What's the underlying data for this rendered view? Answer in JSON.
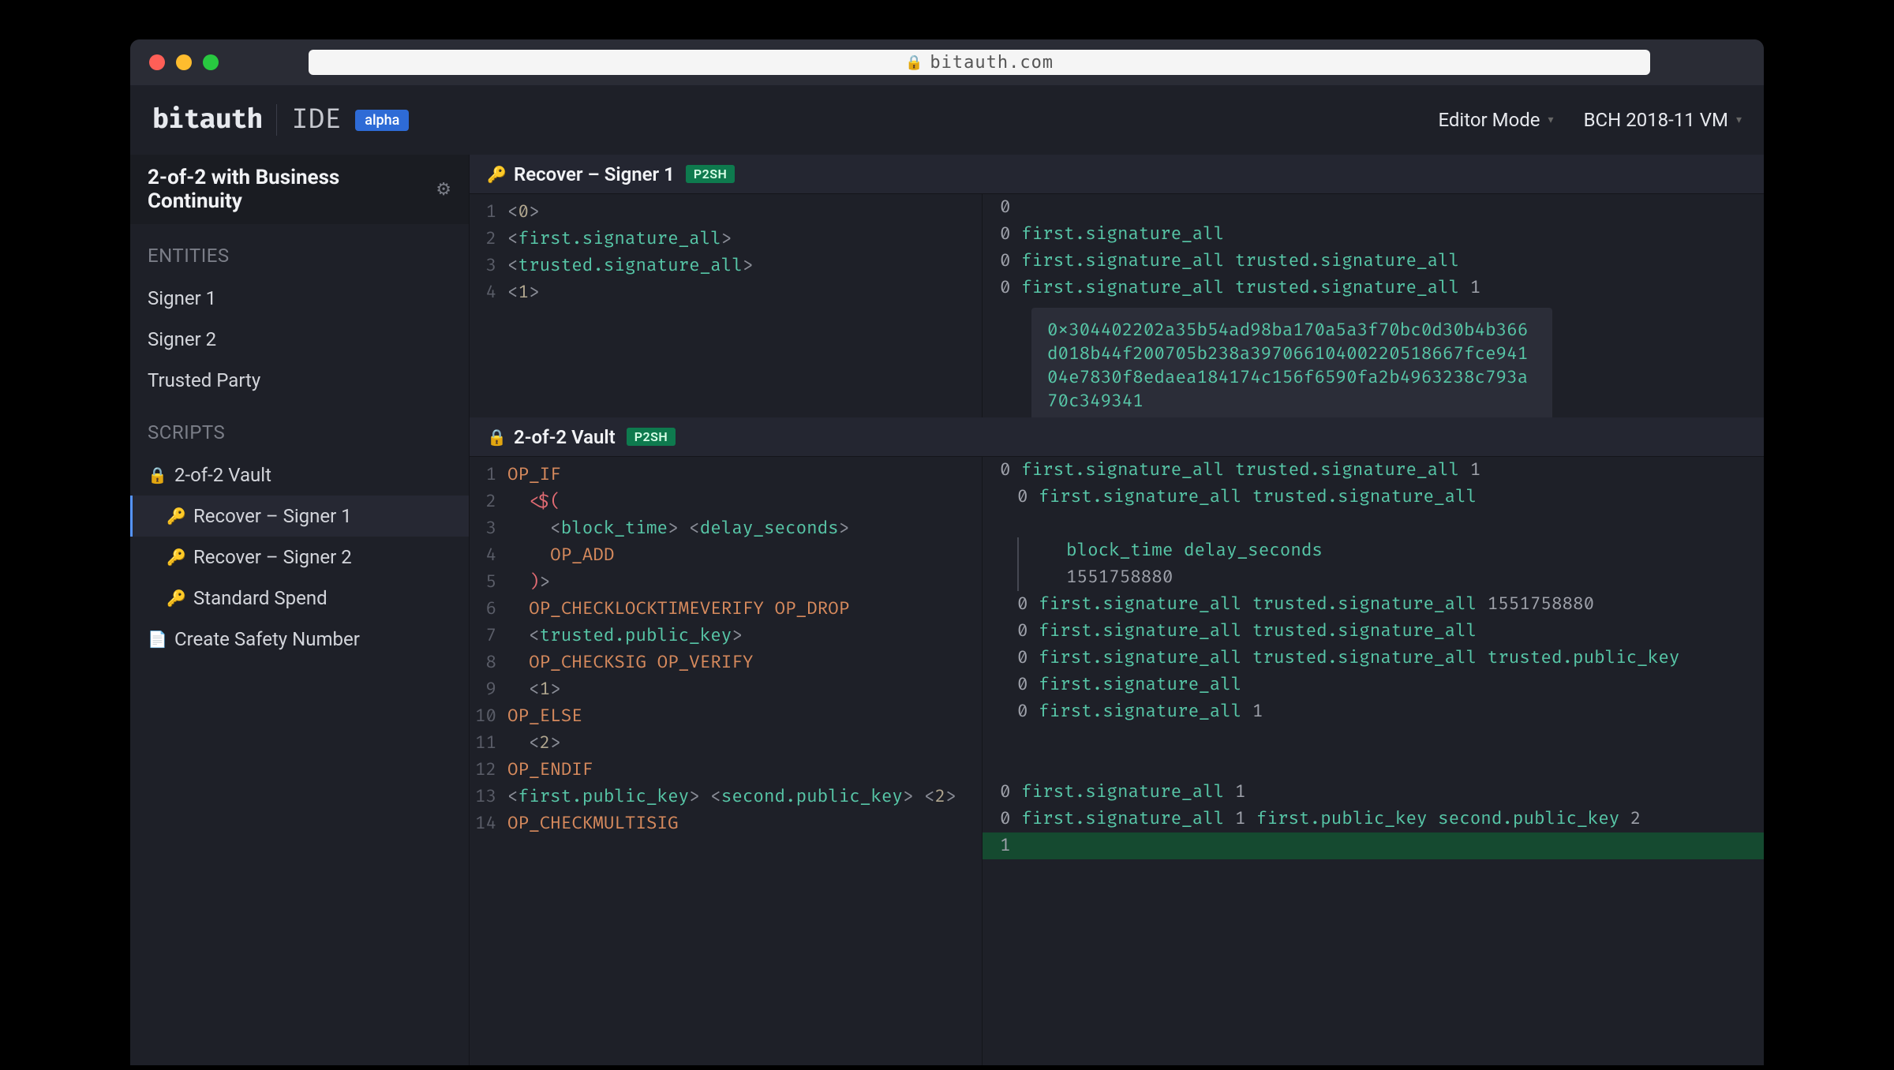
{
  "url": "bitauth.com",
  "brand": "bitauth",
  "ide_label": "IDE",
  "alpha_badge": "alpha",
  "header_dropdowns": {
    "editor_mode": "Editor Mode",
    "vm": "BCH 2018-11 VM"
  },
  "sidebar": {
    "title": "2-of-2 with Business Continuity",
    "section_entities": "ENTITIES",
    "entities": [
      "Signer 1",
      "Signer 2",
      "Trusted Party"
    ],
    "section_scripts": "SCRIPTS",
    "scripts": {
      "vault": "2-of-2 Vault",
      "recover1": "Recover – Signer 1",
      "recover2": "Recover – Signer 2",
      "standard": "Standard Spend",
      "create_csn": "Create Safety Number"
    }
  },
  "pane1": {
    "title": "Recover – Signer 1",
    "badge": "P2SH",
    "code": [
      {
        "n": "1",
        "tokens": [
          [
            "tok-punct",
            "<"
          ],
          [
            "tok-num",
            "0"
          ],
          [
            "tok-punct",
            ">"
          ]
        ]
      },
      {
        "n": "2",
        "tokens": [
          [
            "tok-punct",
            "<"
          ],
          [
            "tok-var",
            "first.signature_all"
          ],
          [
            "tok-punct",
            ">"
          ]
        ]
      },
      {
        "n": "3",
        "tokens": [
          [
            "tok-punct",
            "<"
          ],
          [
            "tok-var",
            "trusted.signature_all"
          ],
          [
            "tok-punct",
            ">"
          ]
        ]
      },
      {
        "n": "4",
        "tokens": [
          [
            "tok-punct",
            "<"
          ],
          [
            "tok-num",
            "1"
          ],
          [
            "tok-punct",
            ">"
          ]
        ]
      }
    ],
    "eval": [
      "0",
      "0 first.signature_all",
      "0 first.signature_all  trusted.signature_all",
      "0 first.signature_all  trusted.signature_all 1"
    ],
    "tooltip": "0x304402202a35b54ad98ba170a5a3f70bc0d30b4b366d018b44f200705b238a39706610400220518667fce94104e7830f8edaea184174c156f6590fa2b4963238c793a70c349341"
  },
  "pane2": {
    "title": "2-of-2 Vault",
    "badge": "P2SH",
    "code_lines": [
      {
        "n": "1",
        "raw": [
          [
            "tok-op",
            "OP_IF"
          ]
        ]
      },
      {
        "n": "2",
        "raw": [
          [
            "",
            "  "
          ],
          [
            "tok-punct",
            "<"
          ],
          [
            "tok-key",
            "$("
          ]
        ]
      },
      {
        "n": "3",
        "raw": [
          [
            "",
            "    "
          ],
          [
            "tok-punct",
            "<"
          ],
          [
            "tok-var",
            "block_time"
          ],
          [
            "tok-punct",
            ">"
          ],
          [
            "",
            ""
          ],
          [
            "tok-punct",
            " <"
          ],
          [
            "tok-var",
            "delay_seconds"
          ],
          [
            "tok-punct",
            ">"
          ]
        ]
      },
      {
        "n": "4",
        "raw": [
          [
            "",
            "    "
          ],
          [
            "tok-op",
            "OP_ADD"
          ]
        ]
      },
      {
        "n": "5",
        "raw": [
          [
            "",
            "  "
          ],
          [
            "tok-key",
            ")"
          ],
          [
            "tok-punct",
            ">"
          ]
        ]
      },
      {
        "n": "6",
        "raw": [
          [
            "",
            "  "
          ],
          [
            "tok-op",
            "OP_CHECKLOCKTIMEVERIFY"
          ],
          [
            "",
            " "
          ],
          [
            "tok-op",
            "OP_DROP"
          ]
        ]
      },
      {
        "n": "7",
        "raw": [
          [
            "",
            "  "
          ],
          [
            "tok-punct",
            "<"
          ],
          [
            "tok-var",
            "trusted.public_key"
          ],
          [
            "tok-punct",
            ">"
          ]
        ]
      },
      {
        "n": "8",
        "raw": [
          [
            "",
            "  "
          ],
          [
            "tok-op",
            "OP_CHECKSIG"
          ],
          [
            "",
            " "
          ],
          [
            "tok-op",
            "OP_VERIFY"
          ]
        ]
      },
      {
        "n": "9",
        "raw": [
          [
            "",
            "  "
          ],
          [
            "tok-punct",
            "<"
          ],
          [
            "tok-num",
            "1"
          ],
          [
            "tok-punct",
            ">"
          ]
        ]
      },
      {
        "n": "10",
        "raw": [
          [
            "tok-op",
            "OP_ELSE"
          ]
        ]
      },
      {
        "n": "11",
        "raw": [
          [
            "",
            "  "
          ],
          [
            "tok-punct",
            "<"
          ],
          [
            "tok-num",
            "2"
          ],
          [
            "tok-punct",
            ">"
          ]
        ]
      },
      {
        "n": "12",
        "raw": [
          [
            "tok-op",
            "OP_ENDIF"
          ]
        ]
      },
      {
        "n": "13",
        "raw": [
          [
            "tok-punct",
            "<"
          ],
          [
            "tok-var",
            "first.public_key"
          ],
          [
            "tok-punct",
            ">"
          ],
          [
            "",
            " "
          ],
          [
            "tok-punct",
            "<"
          ],
          [
            "tok-var",
            "second.public_key"
          ],
          [
            "tok-punct",
            ">"
          ],
          [
            "",
            " "
          ],
          [
            "tok-punct",
            "<"
          ],
          [
            "tok-num",
            "2"
          ],
          [
            "tok-punct",
            ">"
          ]
        ]
      },
      {
        "n": "14",
        "raw": [
          [
            "tok-op",
            "OP_CHECKMULTISIG"
          ]
        ]
      }
    ],
    "eval_lines": [
      {
        "indent": 0,
        "txt": "0 first.signature_all  trusted.signature_all 1"
      },
      {
        "indent": 1,
        "txt": "0 first.signature_all  trusted.signature_all"
      },
      {
        "indent": 0,
        "txt": ""
      },
      {
        "indent": 2,
        "txt": "block_time  delay_seconds"
      },
      {
        "indent": 2,
        "txt": "1551758880"
      },
      {
        "indent": 1,
        "txt": "0 first.signature_all  trusted.signature_all  1551758880"
      },
      {
        "indent": 1,
        "txt": "0 first.signature_all  trusted.signature_all"
      },
      {
        "indent": 1,
        "txt": "0 first.signature_all  trusted.signature_all  trusted.public_key"
      },
      {
        "indent": 1,
        "txt": "0 first.signature_all"
      },
      {
        "indent": 1,
        "txt": "0 first.signature_all  1"
      },
      {
        "indent": 0,
        "txt": ""
      },
      {
        "indent": 0,
        "txt": ""
      },
      {
        "indent": 0,
        "txt": "0 first.signature_all  1"
      },
      {
        "indent": 0,
        "txt": "0 first.signature_all  1  first.public_key  second.public_key  2"
      },
      {
        "indent": 0,
        "txt": "1",
        "hili": true
      }
    ]
  }
}
